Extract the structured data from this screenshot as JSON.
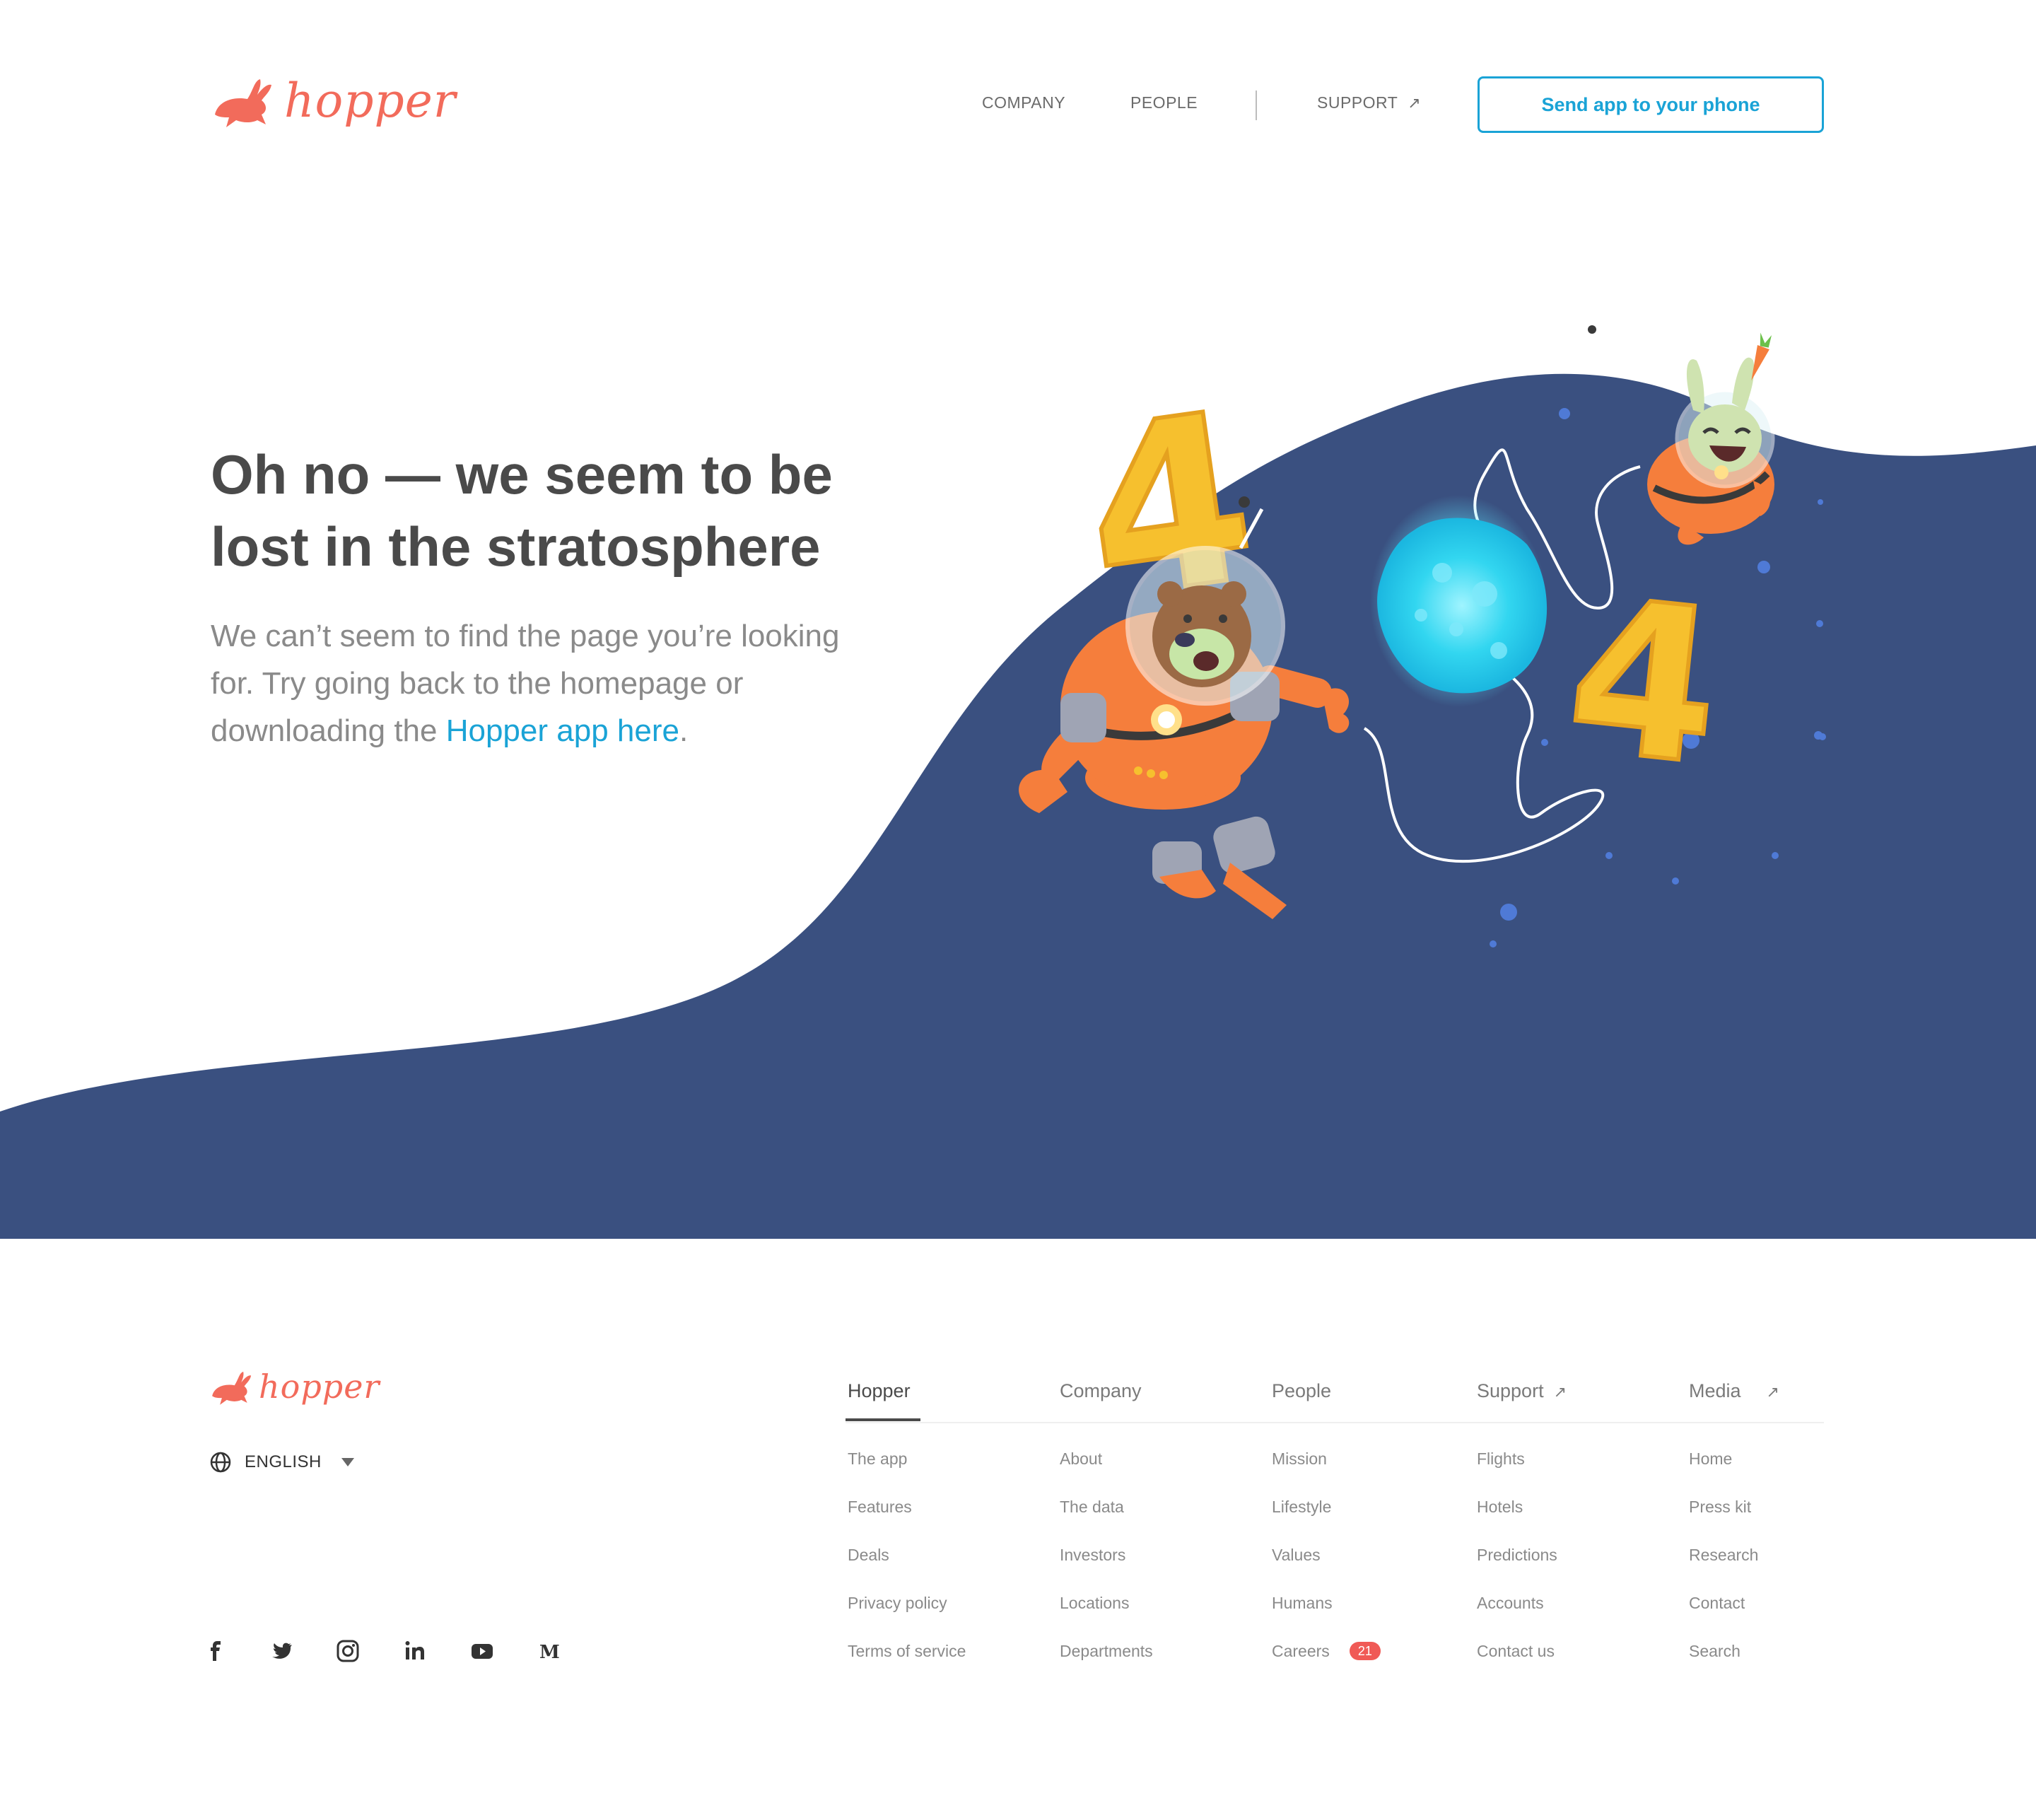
{
  "colors": {
    "brand": "#f26b5b",
    "accent": "#1aa3d6",
    "space": "#3a5080",
    "heading": "#4a4a4a",
    "body": "#8a8a8a",
    "badge": "#f05a56"
  },
  "header": {
    "brand_name": "hopper",
    "nav": [
      "COMPANY",
      "PEOPLE",
      "SUPPORT"
    ],
    "support_icon": "external-arrow-icon",
    "cta": "Send app to your phone"
  },
  "hero": {
    "title": "Oh no — we seem to be lost in the stratosphere",
    "text_before": "We can’t seem to find the page you’re looking for. Try going back to the homepage or downloading the ",
    "link": "Hopper app here",
    "text_after": ".",
    "illustration_text": [
      "4",
      "4"
    ]
  },
  "footer": {
    "brand_name": "hopper",
    "language": "ENGLISH",
    "social": [
      "facebook-icon",
      "twitter-icon",
      "instagram-icon",
      "linkedin-icon",
      "youtube-icon",
      "medium-icon"
    ],
    "columns": [
      {
        "title": "Hopper",
        "items": [
          "The app",
          "Features",
          "Deals",
          "Privacy policy",
          "Terms of service"
        ]
      },
      {
        "title": "Company",
        "items": [
          "About",
          "The data",
          "Investors",
          "Locations",
          "Departments"
        ]
      },
      {
        "title": "People",
        "items": [
          "Mission",
          "Lifestyle",
          "Values",
          "Humans",
          "Careers"
        ]
      },
      {
        "title": "Support",
        "items": [
          "Flights",
          "Hotels",
          "Predictions",
          "Accounts",
          "Contact us"
        ]
      },
      {
        "title": "Media",
        "items": [
          "Home",
          "Press kit",
          "Research",
          "Contact",
          "Search"
        ]
      }
    ],
    "careers_badge": "21"
  }
}
